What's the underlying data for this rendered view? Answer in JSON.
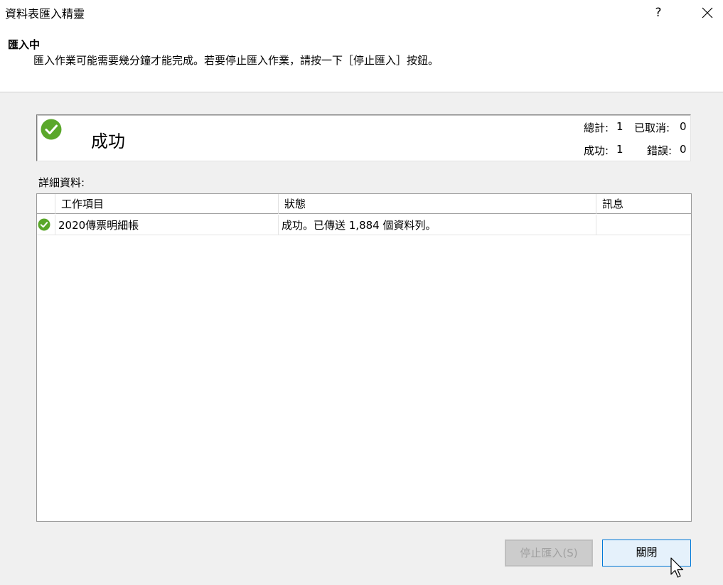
{
  "window": {
    "title": "資料表匯入精靈",
    "help_label": "?",
    "close_icon": "close-icon"
  },
  "header": {
    "title": "匯入中",
    "description": "匯入作業可能需要幾分鐘才能完成。若要停止匯入作業，請按一下［停止匯入］按鈕。"
  },
  "status": {
    "icon": "success-check-icon",
    "text": "成功",
    "total_label": "總計:",
    "total_value": "1",
    "cancelled_label": "已取消:",
    "cancelled_value": "0",
    "success_label": "成功:",
    "success_value": "1",
    "error_label": "錯誤:",
    "error_value": "0"
  },
  "details": {
    "label": "詳細資料:",
    "columns": [
      "工作項目",
      "狀態",
      "訊息"
    ],
    "rows": [
      {
        "icon": "success-check-icon",
        "item": "2020傳票明細帳",
        "status": "成功。已傳送 1,884 個資料列。",
        "message": ""
      }
    ]
  },
  "buttons": {
    "stop_label": "停止匯入(S)",
    "close_label": "關閉"
  },
  "colors": {
    "success_green": "#5aa72a",
    "focus_blue": "#0078d7"
  }
}
